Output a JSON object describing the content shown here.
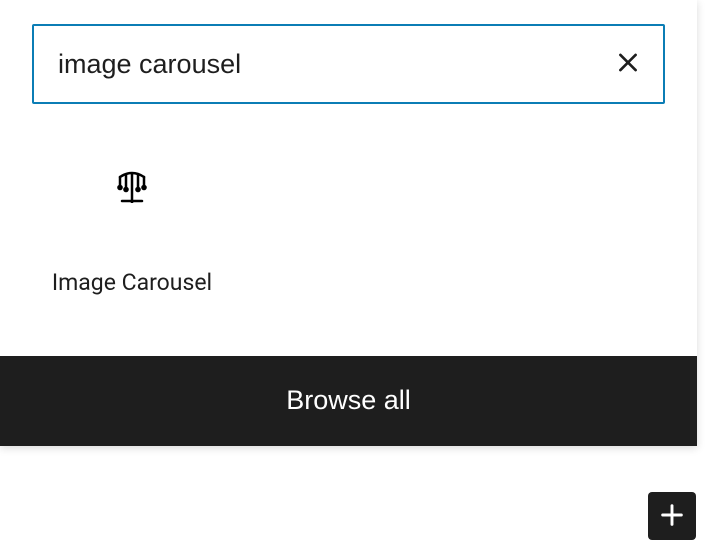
{
  "search": {
    "value": "image carousel"
  },
  "results": [
    {
      "label": "Image Carousel",
      "icon": "carousel-icon"
    }
  ],
  "footer": {
    "browse_all_label": "Browse all"
  }
}
